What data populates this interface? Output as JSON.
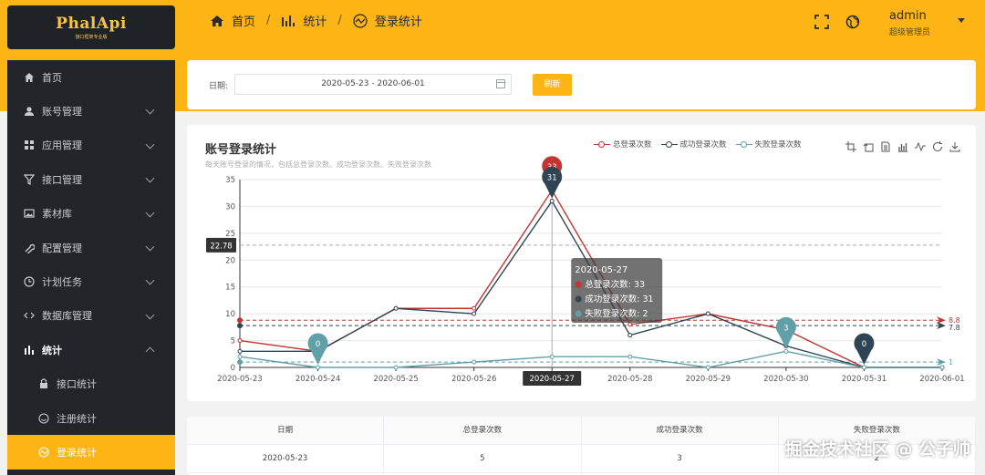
{
  "app": {
    "logo": "PhalApi",
    "logo_sub": "接口框架专业版"
  },
  "breadcrumb": [
    {
      "label": "首页",
      "icon": "home-icon"
    },
    {
      "label": "统计",
      "icon": "bar-chart-icon"
    },
    {
      "label": "登录统计",
      "icon": "trend-icon"
    }
  ],
  "header": {
    "user": "admin",
    "role": "超级管理员"
  },
  "sidebar": {
    "items": [
      {
        "label": "首页",
        "icon": "home-icon"
      },
      {
        "label": "账号管理",
        "icon": "user-icon",
        "expandable": true
      },
      {
        "label": "应用管理",
        "icon": "grid-icon",
        "expandable": true
      },
      {
        "label": "接口管理",
        "icon": "funnel-icon",
        "expandable": true
      },
      {
        "label": "素材库",
        "icon": "image-icon",
        "expandable": true
      },
      {
        "label": "配置管理",
        "icon": "wrench-icon",
        "expandable": true
      },
      {
        "label": "计划任务",
        "icon": "clock-icon",
        "expandable": true
      },
      {
        "label": "数据库管理",
        "icon": "code-icon",
        "expandable": true
      },
      {
        "label": "统计",
        "icon": "bar-chart-icon",
        "expandable": true,
        "open": true
      },
      {
        "label": "接口统计",
        "icon": "lock-icon",
        "sub": true
      },
      {
        "label": "注册统计",
        "icon": "smile-icon",
        "sub": true
      },
      {
        "label": "登录统计",
        "icon": "trend-icon",
        "sub": true,
        "active": true
      }
    ]
  },
  "filter": {
    "date_label": "日期:",
    "date_value": "2020-05-23 - 2020-06-01",
    "refresh_label": "刷新"
  },
  "chart_card": {
    "title": "账号登录统计",
    "subtitle": "每天账号登录的情况，包括总登录次数、成功登录次数、失败登录次数"
  },
  "colors": {
    "accent": "#fcb514",
    "total": "#c23531",
    "success": "#2f4554",
    "fail": "#61a0a8"
  },
  "chart_data": {
    "type": "line",
    "x": [
      "2020-05-23",
      "2020-05-24",
      "2020-05-25",
      "2020-05-26",
      "2020-05-27",
      "2020-05-28",
      "2020-05-29",
      "2020-05-30",
      "2020-05-31",
      "2020-06-01"
    ],
    "series": [
      {
        "name": "总登录次数",
        "values": [
          5,
          3,
          11,
          11,
          33,
          8,
          10,
          7,
          0,
          0
        ],
        "color": "#c23531",
        "max_label": "33",
        "avg": 8.8,
        "avg_label": "8.8"
      },
      {
        "name": "成功登录次数",
        "values": [
          3,
          3,
          11,
          10,
          31,
          6,
          10,
          4,
          0,
          0
        ],
        "color": "#2f4554",
        "max_label": "31",
        "min_label": "0",
        "avg": 7.8,
        "avg_label": "7.8"
      },
      {
        "name": "失败登录次数",
        "values": [
          2,
          0,
          0,
          1,
          2,
          2,
          0,
          3,
          0,
          0
        ],
        "color": "#61a0a8",
        "max_label": "3",
        "min_label": "0",
        "avg": 1,
        "avg_label": "1"
      }
    ],
    "ylim": [
      0,
      35
    ],
    "yticks": [
      0,
      5,
      10,
      15,
      20,
      25,
      30,
      35
    ],
    "grid": true,
    "legend": "top-right",
    "pointer": {
      "y_value": 22.78,
      "y_label": "22.78",
      "x_index": 4
    },
    "tooltip": {
      "title": "2020-05-27",
      "lines": [
        "总登录次数: 33",
        "成功登录次数: 31",
        "失败登录次数: 2"
      ]
    }
  },
  "table": {
    "headers": [
      "日期",
      "总登录次数",
      "成功登录次数",
      "失败登录次数"
    ],
    "rows": [
      [
        "2020-05-23",
        "5",
        "3",
        "2"
      ]
    ]
  },
  "watermark": "掘金技术社区 @ 公子帅"
}
